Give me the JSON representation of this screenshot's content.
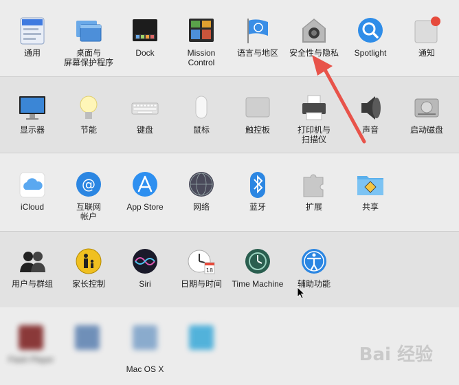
{
  "rows": [
    [
      {
        "label": "通用",
        "icon": "general-icon"
      },
      {
        "label": "桌面与\n屏幕保护程序",
        "icon": "desktop-screensaver-icon"
      },
      {
        "label": "Dock",
        "icon": "dock-icon"
      },
      {
        "label": "Mission\nControl",
        "icon": "mission-control-icon"
      },
      {
        "label": "语言与地区",
        "icon": "language-region-icon"
      },
      {
        "label": "安全性与隐私",
        "icon": "security-privacy-icon"
      },
      {
        "label": "Spotlight",
        "icon": "spotlight-icon"
      },
      {
        "label": "通知",
        "icon": "notifications-icon"
      }
    ],
    [
      {
        "label": "显示器",
        "icon": "displays-icon"
      },
      {
        "label": "节能",
        "icon": "energy-saver-icon"
      },
      {
        "label": "键盘",
        "icon": "keyboard-icon"
      },
      {
        "label": "鼠标",
        "icon": "mouse-icon"
      },
      {
        "label": "触控板",
        "icon": "trackpad-icon"
      },
      {
        "label": "打印机与\n扫描仪",
        "icon": "printers-scanners-icon"
      },
      {
        "label": "声音",
        "icon": "sound-icon"
      },
      {
        "label": "启动磁盘",
        "icon": "startup-disk-icon"
      }
    ],
    [
      {
        "label": "iCloud",
        "icon": "icloud-icon"
      },
      {
        "label": "互联网\n帐户",
        "icon": "internet-accounts-icon"
      },
      {
        "label": "App Store",
        "icon": "app-store-icon"
      },
      {
        "label": "网络",
        "icon": "network-icon"
      },
      {
        "label": "蓝牙",
        "icon": "bluetooth-icon"
      },
      {
        "label": "扩展",
        "icon": "extensions-icon"
      },
      {
        "label": "共享",
        "icon": "sharing-icon"
      }
    ],
    [
      {
        "label": "用户与群组",
        "icon": "users-groups-icon"
      },
      {
        "label": "家长控制",
        "icon": "parental-controls-icon"
      },
      {
        "label": "Siri",
        "icon": "siri-icon"
      },
      {
        "label": "日期与时间",
        "icon": "date-time-icon"
      },
      {
        "label": "Time Machine",
        "icon": "time-machine-icon"
      },
      {
        "label": "辅助功能",
        "icon": "accessibility-icon"
      }
    ],
    [
      {
        "label": "Flash Player",
        "icon": "flash-player-icon"
      },
      {
        "label": "",
        "icon": "third-party-icon"
      },
      {
        "label": "Mac OS X",
        "icon": "third-party-icon"
      },
      {
        "label": "",
        "icon": "third-party-icon"
      }
    ]
  ],
  "watermark": "Bai 经验",
  "colors": {
    "arrow": "#e8534a"
  }
}
